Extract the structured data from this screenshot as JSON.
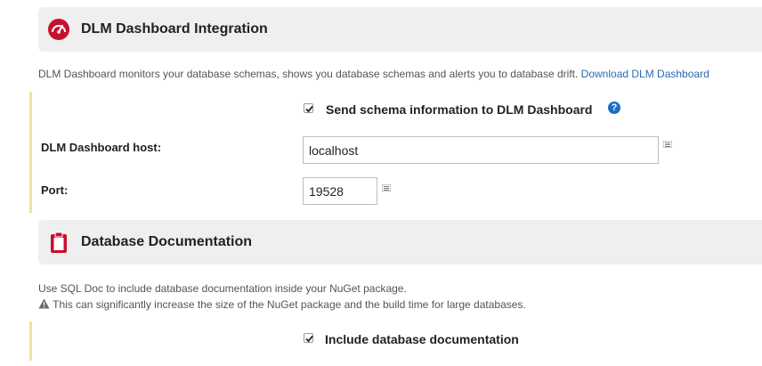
{
  "dlm": {
    "title": "DLM Dashboard Integration",
    "description": "DLM Dashboard monitors your database schemas, shows you database schemas and alerts you to database drift.",
    "download_link": "Download DLM Dashboard",
    "send_schema_label": "Send schema information to DLM Dashboard",
    "send_schema_checked": true,
    "host_label": "DLM Dashboard host:",
    "host_value": "localhost",
    "port_label": "Port:",
    "port_value": "19528",
    "help_glyph": "?",
    "icons": {
      "header": "speedometer-icon",
      "help": "help-icon",
      "field": "list-icon"
    },
    "colors": {
      "icon_red": "#c8102e",
      "help_blue": "#1a6fc4",
      "accent_yellow": "#f4e19c",
      "link": "#2a6ab0"
    }
  },
  "docs": {
    "title": "Database Documentation",
    "description": "Use SQL Doc to include database documentation inside your NuGet package.",
    "warning": "This can significantly increase the size of the NuGet package and the build time for large databases.",
    "include_label": "Include database documentation",
    "include_checked": true,
    "icons": {
      "header": "clipboard-icon",
      "warning": "warning-icon"
    }
  }
}
